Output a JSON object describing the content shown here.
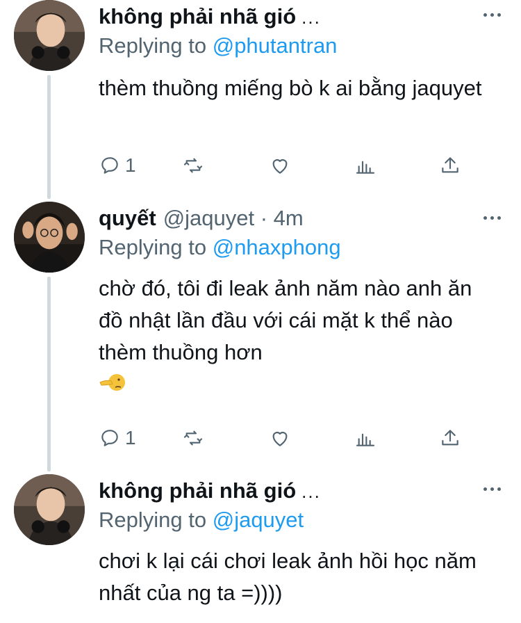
{
  "tweets": [
    {
      "name": "không phải nhã gió",
      "name_truncated": "...",
      "handle": "",
      "replying_label": "Replying to",
      "replying_to": "@phutantran",
      "text": "thèm thuồng miếng bò k ai bằng jaquyet",
      "reply_count": "1",
      "avatar_icon": "profile-photo-1"
    },
    {
      "name": "quyết",
      "handle": "@jaquyet · 4m",
      "replying_label": "Replying to",
      "replying_to": "@nhaxphong",
      "text": "chờ đó, tôi đi leak ảnh năm nào anh ăn đồ nhật lần đầu với cái mặt k thể nào thèm thuồng hơn",
      "emoji": "pointing-face-emoji",
      "reply_count": "1",
      "avatar_icon": "profile-photo-2"
    },
    {
      "name": "không phải nhã gió",
      "name_truncated": "...",
      "handle": "",
      "replying_label": "Replying to",
      "replying_to": "@jaquyet",
      "text": "chơi k lại cái chơi leak ảnh hồi học năm nhất của ng ta =))))",
      "avatar_icon": "profile-photo-1"
    }
  ],
  "colors": {
    "text": "#0f1419",
    "secondary": "#536471",
    "link": "#1d9bf0",
    "thread_line": "#cfd9de"
  }
}
